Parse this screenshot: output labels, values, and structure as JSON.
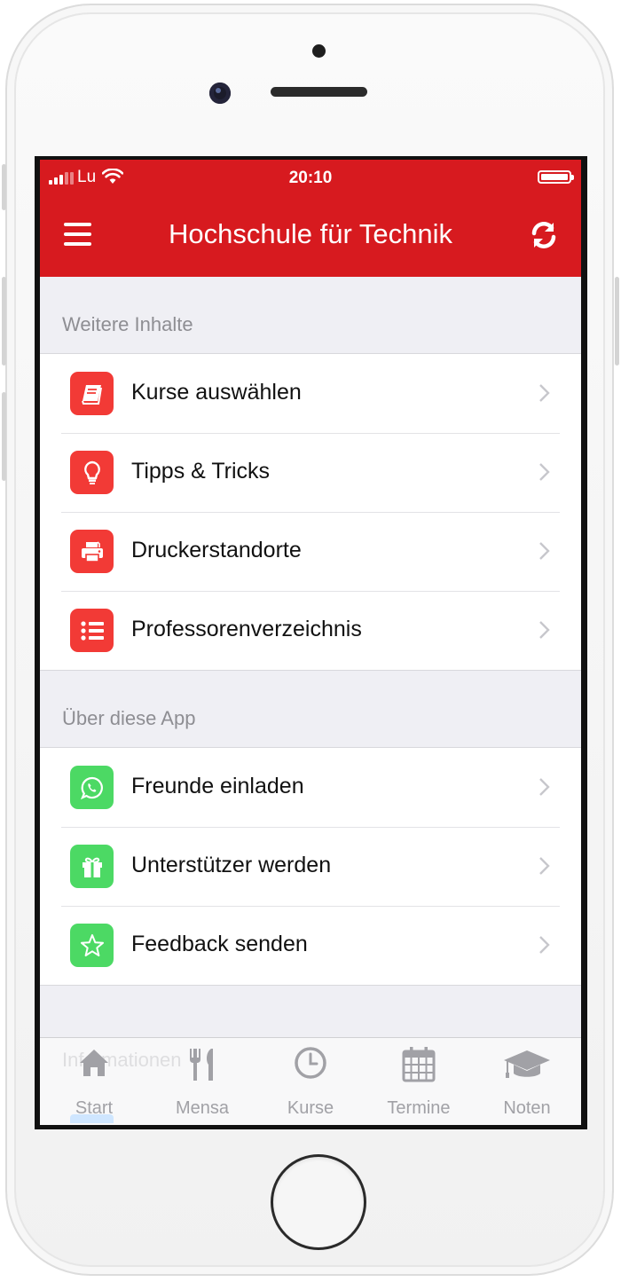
{
  "status_bar": {
    "carrier": "Lu",
    "time": "20:10"
  },
  "nav": {
    "title": "Hochschule für Technik"
  },
  "sections": [
    {
      "header": "Weitere Inhalte",
      "items": [
        {
          "label": "Kurse auswählen",
          "icon": "book-icon",
          "color": "#f23a36"
        },
        {
          "label": "Tipps & Tricks",
          "icon": "lightbulb-icon",
          "color": "#f23a36"
        },
        {
          "label": "Druckerstandorte",
          "icon": "printer-icon",
          "color": "#f23a36"
        },
        {
          "label": "Professorenverzeichnis",
          "icon": "list-icon",
          "color": "#f23a36"
        }
      ]
    },
    {
      "header": "Über diese App",
      "items": [
        {
          "label": "Freunde einladen",
          "icon": "whatsapp-icon",
          "color": "#4cd964"
        },
        {
          "label": "Unterstützer werden",
          "icon": "gift-icon",
          "color": "#4cd964"
        },
        {
          "label": "Feedback senden",
          "icon": "star-icon",
          "color": "#4cd964"
        }
      ]
    }
  ],
  "hidden_section_header": "Informationen",
  "tabbar": {
    "tabs": [
      {
        "label": "Start",
        "icon": "home-icon"
      },
      {
        "label": "Mensa",
        "icon": "fork-knife-icon"
      },
      {
        "label": "Kurse",
        "icon": "clock-icon"
      },
      {
        "label": "Termine",
        "icon": "calendar-icon"
      },
      {
        "label": "Noten",
        "icon": "graduation-cap-icon"
      }
    ]
  },
  "colors": {
    "brand": "#d71a1f",
    "accent_red": "#f23a36",
    "accent_green": "#4cd964",
    "tab_inactive": "#a1a1a6"
  }
}
